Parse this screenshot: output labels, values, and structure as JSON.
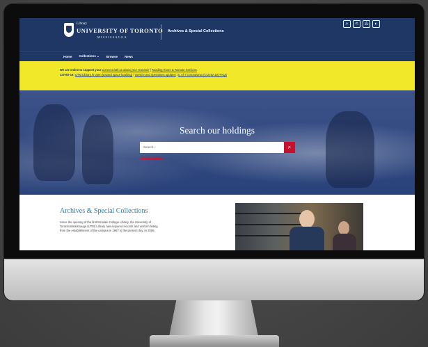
{
  "header": {
    "library_label": "Library",
    "university": "UNIVERSITY OF TORONTO",
    "campus": "MISSISSAUGA",
    "site_title": "Archives & Special Collections",
    "icons": [
      "search-icon",
      "share-icon",
      "user-icon",
      "contrast-icon"
    ]
  },
  "nav": {
    "items": [
      {
        "label": "Home"
      },
      {
        "label": "Collections ⌄"
      },
      {
        "label": "Browse"
      },
      {
        "label": "News"
      }
    ]
  },
  "alert": {
    "line1_bold": "We are online to support you!",
    "line1_link1": "Connect with us about your research",
    "line1_link2": "Reading Room & Remote Services",
    "line2_bold": "COVID-19:",
    "line2_link1": "UTM Library is open (toward space booking)",
    "line2_link2": "Service and operations updates",
    "line2_link3": "U of T Coronavirus (COVID-19) FAQs",
    "separator": "|"
  },
  "hero": {
    "title": "Search our holdings",
    "search_placeholder": "Search...",
    "advanced_label": "Advanced Search"
  },
  "about": {
    "title": "Archives & Special Collections",
    "line1": "Since the opening of the first Erindale College Library, the University of",
    "line2": "Toronto Mississauga (UTM) Library has acquired records and uniform listing",
    "line3": "from the establishment of the campus in 1967 to the present day. In 2006,"
  },
  "colors": {
    "brand_navy": "#1e3765",
    "alert_yellow": "#f2e82a",
    "search_red": "#c8102e",
    "title_blue": "#1f7fb5"
  }
}
